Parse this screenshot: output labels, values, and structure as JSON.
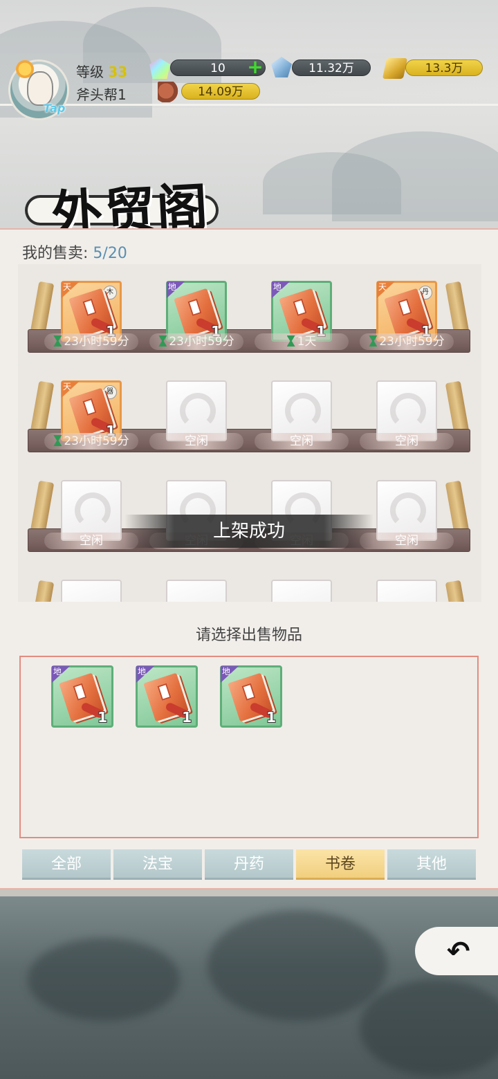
{
  "hud": {
    "level_label": "等级",
    "level_value": "33",
    "guild": "斧头帮1",
    "tap_label": "Tap",
    "resources": {
      "gems": "10",
      "crystals": "11.32万",
      "gold": "13.3万",
      "meat": "14.09万"
    }
  },
  "page": {
    "title": "外贸阁",
    "my_sales_label": "我的售卖:",
    "my_sales_count": "5/20"
  },
  "shelves": [
    [
      {
        "state": "item",
        "tier": "天",
        "mark": "木",
        "qty": "1",
        "time": "23小时59分"
      },
      {
        "state": "item",
        "tier": "地",
        "mark": "",
        "qty": "1",
        "time": "23小时59分"
      },
      {
        "state": "item",
        "tier": "地",
        "mark": "",
        "qty": "1",
        "time": "1天"
      },
      {
        "state": "item",
        "tier": "天",
        "mark": "丹",
        "qty": "1",
        "time": "23小时59分"
      }
    ],
    [
      {
        "state": "item",
        "tier": "天",
        "mark": "器",
        "qty": "1",
        "time": "23小时59分"
      },
      {
        "state": "empty",
        "label": "空闲"
      },
      {
        "state": "empty",
        "label": "空闲"
      },
      {
        "state": "empty",
        "label": "空闲"
      }
    ],
    [
      {
        "state": "empty",
        "label": "空闲"
      },
      {
        "state": "empty",
        "label": "空闲"
      },
      {
        "state": "empty",
        "label": "空闲"
      },
      {
        "state": "empty",
        "label": "空闲"
      }
    ]
  ],
  "toast": "上架成功",
  "select_prompt": "请选择出售物品",
  "inventory": [
    {
      "tier": "地",
      "qty": "1"
    },
    {
      "tier": "地",
      "qty": "1"
    },
    {
      "tier": "地",
      "qty": "1"
    }
  ],
  "tabs": [
    {
      "label": "全部",
      "active": false
    },
    {
      "label": "法宝",
      "active": false
    },
    {
      "label": "丹药",
      "active": false
    },
    {
      "label": "书卷",
      "active": true
    },
    {
      "label": "其他",
      "active": false
    }
  ],
  "colors": {
    "orange_item": "#f3b060",
    "green_item": "#80c796",
    "active_tab": "#f1cf7e",
    "tab": "#b3c7ca"
  }
}
